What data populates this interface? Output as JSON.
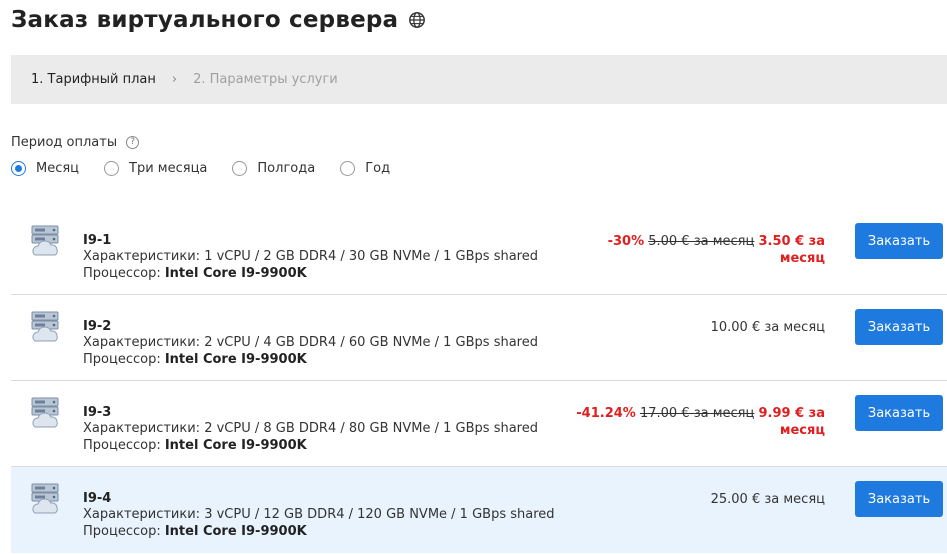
{
  "header": {
    "title": "Заказ виртуального сервера"
  },
  "steps": [
    {
      "label": "1. Тарифный план"
    },
    {
      "label": "2. Параметры услуги"
    }
  ],
  "period": {
    "label": "Период оплаты",
    "help": "?",
    "options": [
      {
        "label": "Месяц",
        "checked": true
      },
      {
        "label": "Три месяца",
        "checked": false
      },
      {
        "label": "Полгода",
        "checked": false
      },
      {
        "label": "Год",
        "checked": false
      }
    ]
  },
  "plans": [
    {
      "name": "I9-1",
      "specs": "Характеристики: 1 vCPU / 2 GB DDR4 / 30 GB NVMe / 1 GBps shared",
      "cpu_label": "Процессор: ",
      "cpu": "Intel Core I9-9900K",
      "discount": "-30%",
      "old_price": "5.00 € за месяц",
      "price": "3.50 € за месяц",
      "order_label": "Заказать"
    },
    {
      "name": "I9-2",
      "specs": "Характеристики: 2 vCPU / 4 GB DDR4 / 60 GB NVMe / 1 GBps shared",
      "cpu_label": "Процессор: ",
      "cpu": "Intel Core I9-9900K",
      "price": "10.00 € за месяц",
      "order_label": "Заказать"
    },
    {
      "name": "I9-3",
      "specs": "Характеристики: 2 vCPU / 8 GB DDR4 / 80 GB NVMe / 1 GBps shared",
      "cpu_label": "Процессор: ",
      "cpu": "Intel Core I9-9900K",
      "discount": "-41.24%",
      "old_price": "17.00 € за месяц",
      "price": "9.99 € за месяц",
      "order_label": "Заказать"
    },
    {
      "name": "I9-4",
      "specs": "Характеристики: 3 vCPU / 12 GB DDR4 / 120 GB NVMe / 1 GBps shared",
      "cpu_label": "Процессор: ",
      "cpu": "Intel Core I9-9900K",
      "price": "25.00 € за месяц",
      "order_label": "Заказать"
    }
  ],
  "colors": {
    "accent": "#1f7ae0",
    "discount": "#e02020",
    "highlight_row": "#e8f3fd",
    "steps_bg": "#ebebeb"
  }
}
